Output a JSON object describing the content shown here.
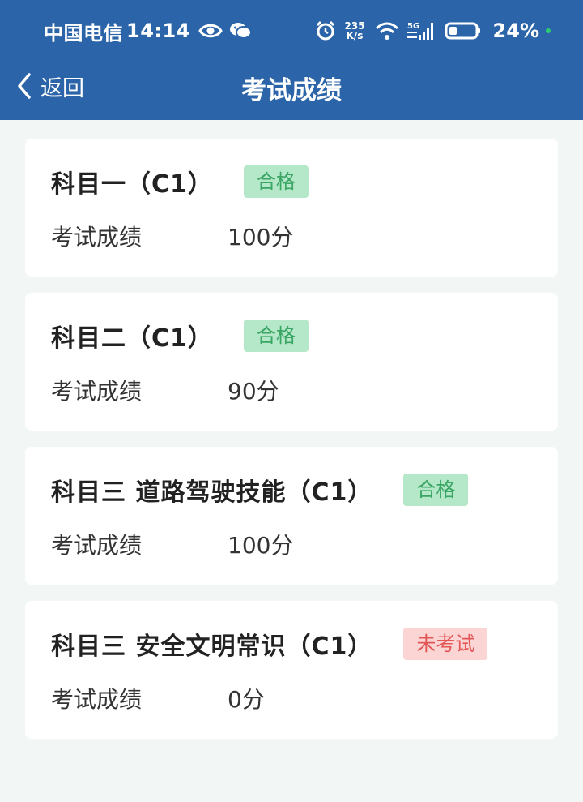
{
  "status_bar": {
    "carrier": "中国电信",
    "time": "14:14",
    "net_speed_top": "235",
    "net_speed_bottom": "K/s",
    "signal_label": "5G",
    "battery": "24%",
    "icons": [
      "eye-icon",
      "wechat-icon",
      "alarm-icon",
      "wifi-icon",
      "signal-icon",
      "battery-icon"
    ]
  },
  "nav": {
    "back_label": "返回",
    "title": "考试成绩"
  },
  "colors": {
    "header_bg": "#2b64a8",
    "page_bg": "#f2f7f6",
    "pass_bg": "#b5e8c8",
    "pass_text": "#3aa564",
    "fail_bg": "#fbd4d4",
    "fail_text": "#e35656"
  },
  "cards": [
    {
      "title": "科目一（C1）",
      "status": "合格",
      "score_label": "考试成绩",
      "score": "100分"
    },
    {
      "title": "科目二（C1）",
      "status": "合格",
      "score_label": "考试成绩",
      "score": "90分"
    },
    {
      "title": "科目三 道路驾驶技能（C1）",
      "status": "合格",
      "score_label": "考试成绩",
      "score": "100分"
    },
    {
      "title": "科目三 安全文明常识（C1）",
      "status": "未考试",
      "score_label": "考试成绩",
      "score": "0分"
    }
  ]
}
